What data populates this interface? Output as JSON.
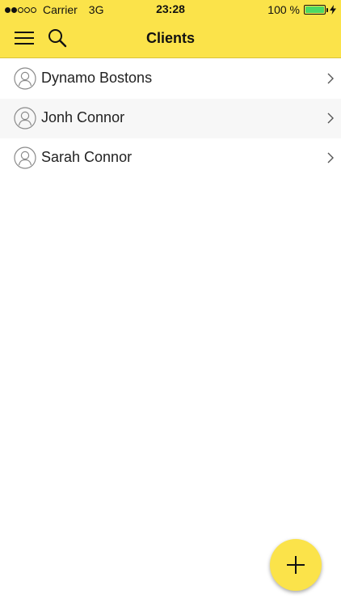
{
  "status_bar": {
    "carrier": "Carrier",
    "network": "3G",
    "time": "23:28",
    "battery_percent": "100 %",
    "signal_strength": 2,
    "signal_max": 5
  },
  "nav": {
    "title": "Clients",
    "menu_icon": "hamburger-menu-icon",
    "search_icon": "search-icon"
  },
  "clients": [
    {
      "name": "Dynamo Bostons"
    },
    {
      "name": "Jonh Connor"
    },
    {
      "name": "Sarah Connor"
    }
  ],
  "fab": {
    "icon": "plus-icon"
  },
  "colors": {
    "accent": "#fbe34a",
    "battery": "#4cd964",
    "row_alt": "#f7f7f7"
  }
}
